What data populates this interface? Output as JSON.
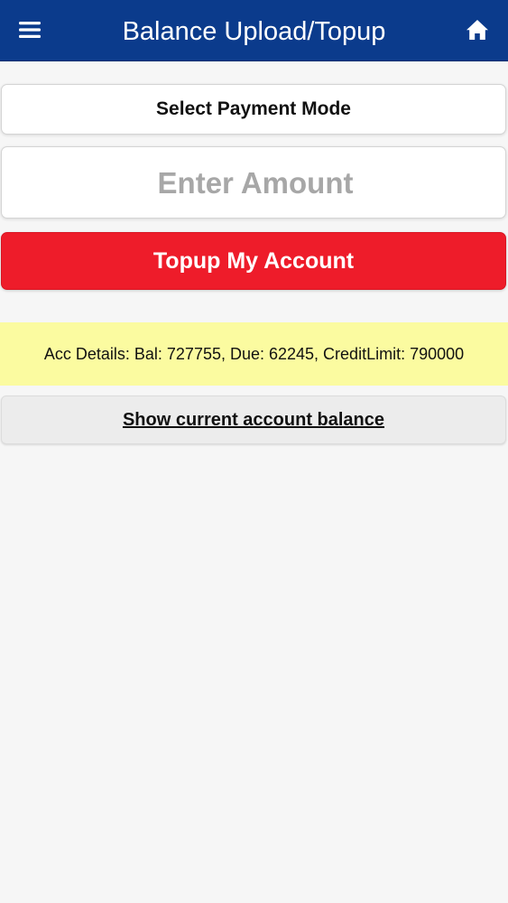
{
  "header": {
    "title": "Balance Upload/Topup",
    "menu_icon": "hamburger-menu-icon",
    "home_icon": "home-icon",
    "background_color": "#0b3b8c"
  },
  "form": {
    "payment_mode_label": "Select Payment Mode",
    "amount_value": "",
    "amount_placeholder": "Enter Amount",
    "topup_button_label": "Topup My Account",
    "topup_button_color": "#ee1c2a"
  },
  "account": {
    "details_text": "Acc Details: Bal: 727755, Due: 62245, CreditLimit: 790000",
    "details_background": "#fbfba0",
    "show_balance_label": "Show current account balance"
  }
}
